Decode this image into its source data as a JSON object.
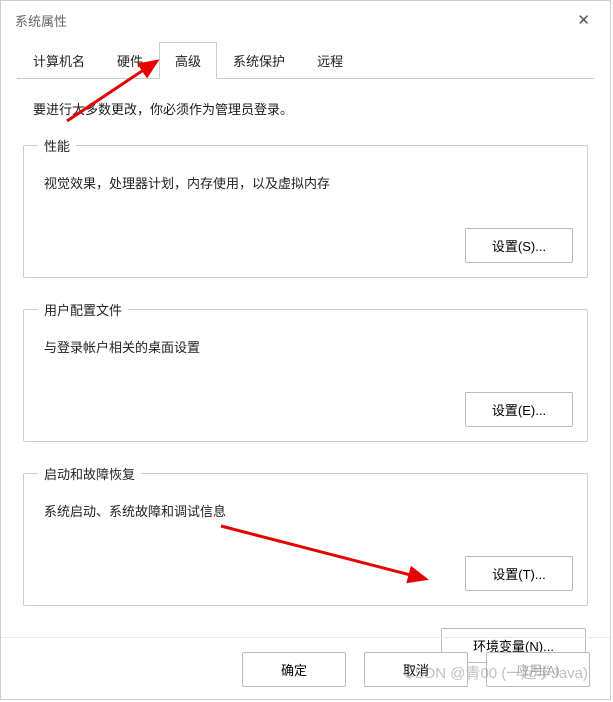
{
  "window": {
    "title": "系统属性"
  },
  "tabs": {
    "items": [
      {
        "label": "计算机名"
      },
      {
        "label": "硬件"
      },
      {
        "label": "高级"
      },
      {
        "label": "系统保护"
      },
      {
        "label": "远程"
      }
    ],
    "active_index": 2
  },
  "intro": "要进行大多数更改，你必须作为管理员登录。",
  "sections": {
    "performance": {
      "legend": "性能",
      "desc": "视觉效果，处理器计划，内存使用，以及虚拟内存",
      "button": "设置(S)..."
    },
    "profiles": {
      "legend": "用户配置文件",
      "desc": "与登录帐户相关的桌面设置",
      "button": "设置(E)..."
    },
    "startup": {
      "legend": "启动和故障恢复",
      "desc": "系统启动、系统故障和调试信息",
      "button": "设置(T)..."
    }
  },
  "env_button": "环境变量(N)...",
  "footer": {
    "ok": "确定",
    "cancel": "取消",
    "apply": "应用(A)"
  },
  "watermark": "CSDN @青00   (一起学Java)"
}
